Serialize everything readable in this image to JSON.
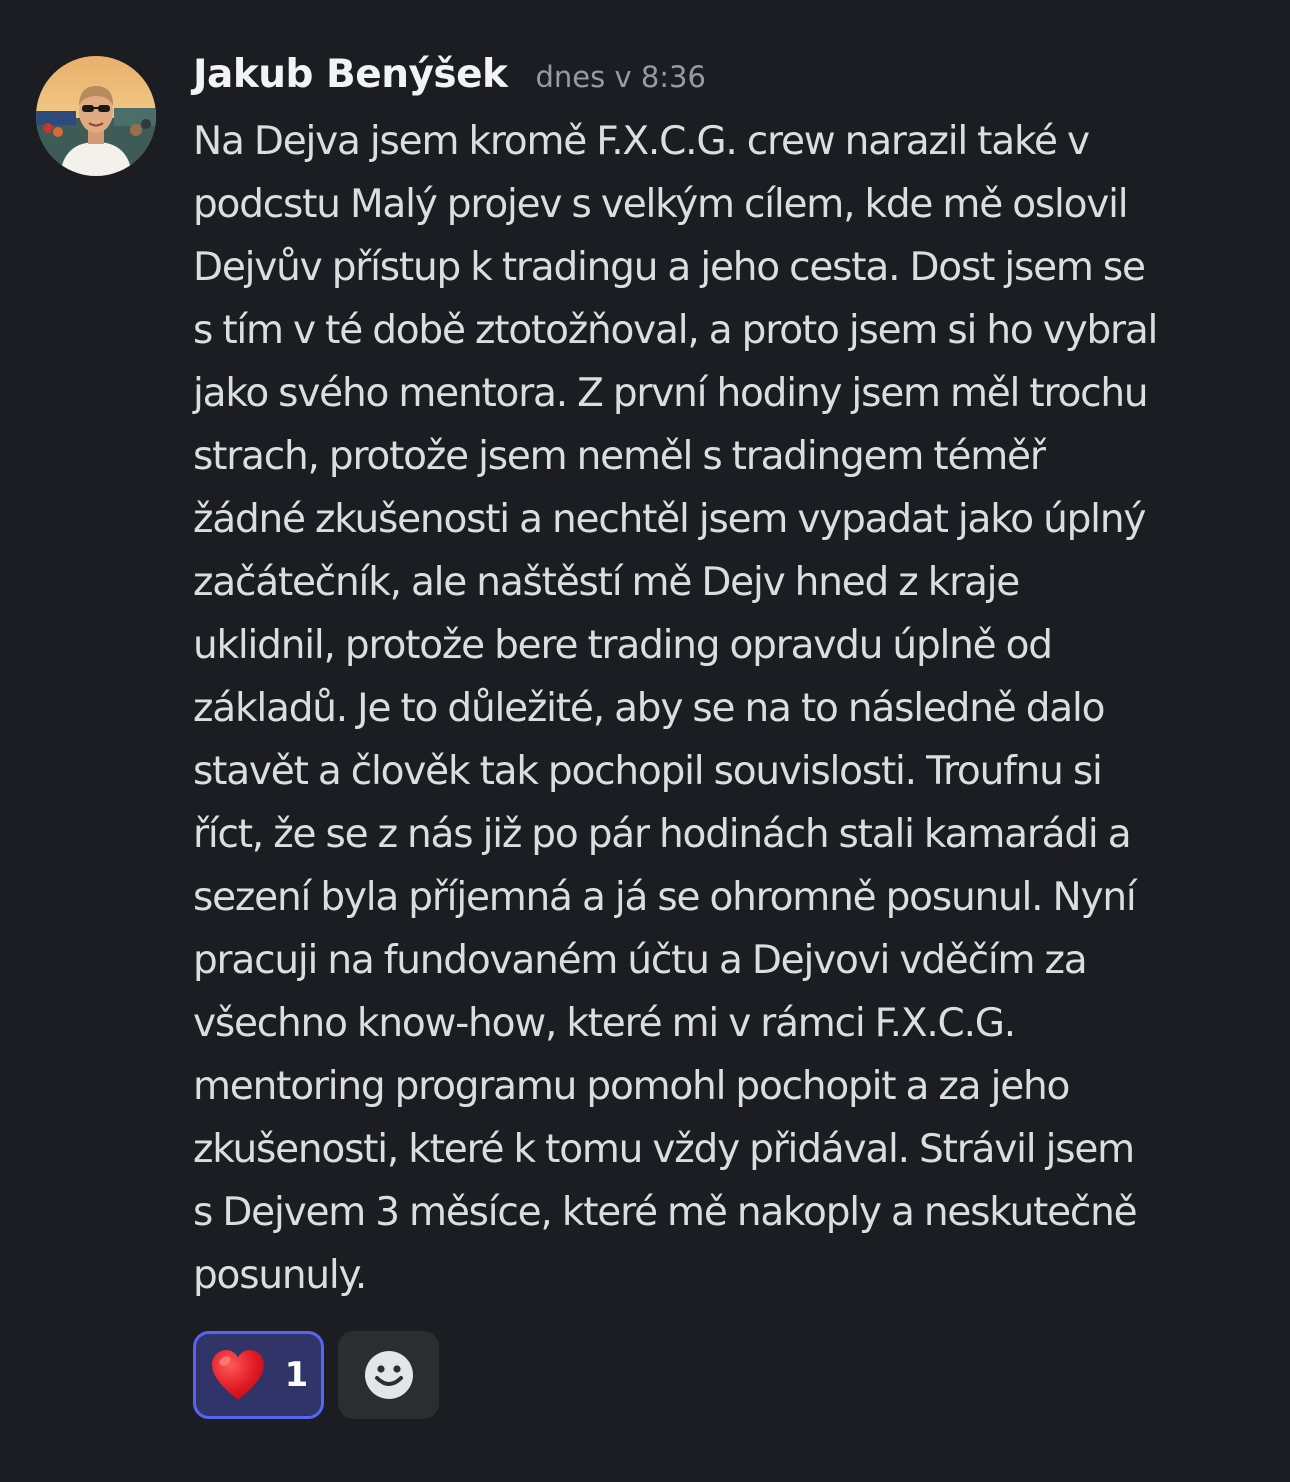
{
  "message": {
    "author": "Jakub Benýšek",
    "timestamp": "dnes v 8:36",
    "avatar_icon": "user-avatar-photo",
    "lines": [
      "Na Dejva jsem kromě F.X.C.G. crew narazil také v",
      "podcstu Malý projev s velkým cílem, kde mě oslovil",
      "Dejvův přístup k tradingu a jeho cesta. Dost jsem se",
      "s tím v té době ztotožňoval, a proto jsem si ho vybral",
      "jako svého mentora. Z první hodiny jsem měl trochu",
      "strach, protože jsem neměl s tradingem téměř",
      "žádné zkušenosti a nechtěl jsem vypadat jako úplný",
      "začátečník, ale naštěstí mě Dejv hned z kraje",
      "uklidnil, protože bere trading opravdu úplně od",
      "základů. Je to důležité, aby se na to následně dalo",
      "stavět a člověk tak pochopil souvislosti. Troufnu si",
      "říct, že se z nás již po pár hodinách stali kamarádi a",
      "sezení byla příjemná a já se ohromně posunul. Nyní",
      "pracuji na fundovaném účtu a Dejvovi vděčím za",
      "všechno know-how, které mi v rámci F.X.C.G.",
      "mentoring programu pomohl pochopit a za jeho",
      "zkušenosti, které k tomu vždy přidával. Strávil jsem",
      "s Dejvem 3 měsíce, které mě nakoply a neskutečně",
      "posunuly."
    ]
  },
  "reactions": [
    {
      "emoji": "❤️",
      "icon": "red-heart-emoji",
      "count": "1",
      "active": true
    }
  ],
  "add_reaction": {
    "icon": "smiley-face-icon"
  },
  "colors": {
    "background": "#1c1d22",
    "author": "#f2f3f5",
    "text": "#dbdee1",
    "timestamp": "#949ba4",
    "reaction_active_bg": "#313468",
    "reaction_active_border": "#5865f2",
    "add_reaction_bg": "#2b2d31"
  }
}
